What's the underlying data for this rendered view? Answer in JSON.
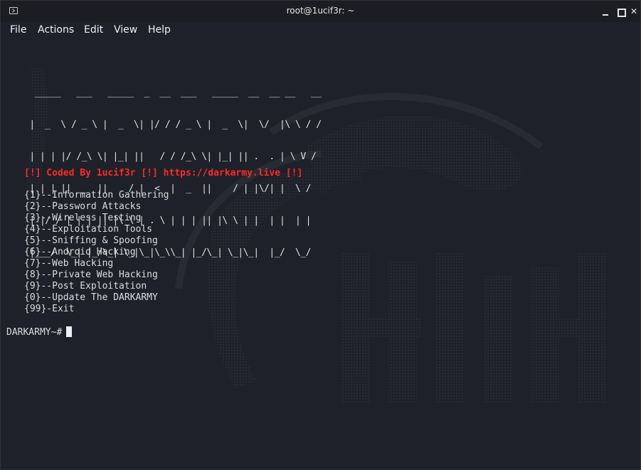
{
  "window": {
    "title": "root@1ucif3r: ~"
  },
  "menu": [
    "File",
    "Actions",
    "Edit",
    "View",
    "Help"
  ],
  "terminal": {
    "banner_lines": [
      "  _____   ___   _____  _  __  ___   _____  __  __ __   __",
      " |  _  \\ / _ \\ |  _  \\| |/ / / _ \\ |  _  \\|  \\/  |\\ \\ / /",
      " | | | |/ /_\\ \\| |_| ||   / / /_\\ \\| |_| || .  . | \\ V / ",
      " | | | ||  _  ||    / |  <  |  _  ||    / | |\\/| |  \\ /  ",
      " | |/ / | | | || |\\ \\ | . \\ | | | || |\\ \\ | |  | |  | |  ",
      " |___/  \\_| |_/\\_| \\_|\\_|\\_\\\\_| |_/\\_| \\_|\\_|  |_/  \\_/  "
    ],
    "coded_by": "[!] Coded By 1ucif3r [!] https://darkarmy.live [!]",
    "options": [
      "{1}--Information Gathering",
      "{2}--Password Attacks",
      "{3}--Wireless Testing",
      "{4}--Exploitation Tools",
      "{5}--Sniffing & Spoofing",
      "{6}--Android Hacking",
      "{7}--Web Hacking",
      "{8}--Private Web Hacking",
      "{9}--Post Exploitation",
      "{0}--Update The DARKARMY",
      "{99}-Exit"
    ],
    "prompt": "DARKARMY~#"
  },
  "colors": {
    "background": "#1e2129",
    "titlebar": "#1b1d22",
    "accent_red": "#ff2a2a",
    "text": "#dcdcdc"
  },
  "icons": {
    "app": "terminal-icon",
    "minimize": "minimize-icon",
    "maximize": "maximize-icon",
    "close": "close-icon"
  }
}
